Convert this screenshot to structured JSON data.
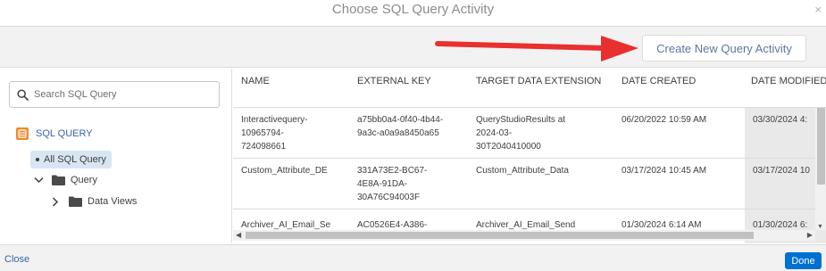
{
  "modal": {
    "title": "Choose SQL Query Activity",
    "close_glyph": "×"
  },
  "toolbar": {
    "create_label": "Create New Query Activity"
  },
  "search": {
    "placeholder": "Search SQL Query"
  },
  "tree": {
    "root_label": "SQL QUERY",
    "selected_label": "All SQL Query",
    "query_label": "Query",
    "data_views_label": "Data Views"
  },
  "table": {
    "columns": [
      "NAME",
      "EXTERNAL KEY",
      "TARGET DATA EXTENSION",
      "DATE CREATED",
      "DATE MODIFIED"
    ],
    "rows": [
      {
        "name": [
          "Interactivequery-",
          "10965794-",
          "724098661"
        ],
        "key": [
          "a75bb0a4-0f40-4b44-",
          "9a3c-a0a9a8450a65"
        ],
        "target": [
          "QueryStudioResults at",
          "2024-03-",
          "30T2040410000"
        ],
        "created": "06/20/2022 10:59 AM",
        "modified": "03/30/2024 4:"
      },
      {
        "name": [
          "Custom_Attribute_DE"
        ],
        "key": [
          "331A73E2-BC67-",
          "4E8A-91DA-",
          "30A76C94003F"
        ],
        "target": [
          "Custom_Attribute_Data"
        ],
        "created": "03/17/2024 10:45 AM",
        "modified": "03/17/2024 10"
      },
      {
        "name": [
          "Archiver_AI_Email_Se"
        ],
        "key": [
          "AC0526E4-A386-"
        ],
        "target": [
          "Archiver_AI_Email_Send"
        ],
        "created": "01/30/2024 6:14 AM",
        "modified": "01/30/2024 6:"
      }
    ]
  },
  "footer": {
    "close_label": "Close",
    "done_label": "Done"
  },
  "colors": {
    "accent": "#0070d2",
    "link": "#3565a8",
    "arrow": "#e8302f",
    "sql_icon": "#f08a2b"
  }
}
